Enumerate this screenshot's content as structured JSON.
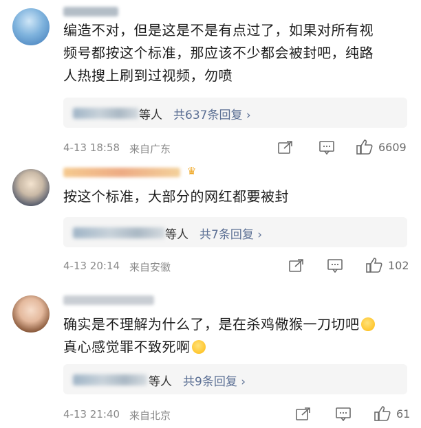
{
  "comments": [
    {
      "text_lines": [
        "编造不对，但是这是不是有点过了，如果对所有视",
        "频号都按这个标准，那应该不少都会被封吧，纯路",
        "人热搜上刷到过视频，勿喷"
      ],
      "replies_who": "等人",
      "replies_link": "共637条回复 ›",
      "time": "4-13 18:58",
      "location": "来自广东",
      "likes": "6609"
    },
    {
      "text_lines": [
        "按这个标准，大部分的网红都要被封"
      ],
      "replies_who": "等人",
      "replies_link": "共7条回复 ›",
      "time": "4-13 20:14",
      "location": "来自安徽",
      "likes": "102"
    },
    {
      "text_lines": [
        "确实是不理解为什么了，是在杀鸡儆猴一刀切吧",
        "真心感觉罪不致死啊"
      ],
      "replies_who": "等人",
      "replies_link": "共9条回复 ›",
      "time": "4-13 21:40",
      "location": "来自北京",
      "likes": "61"
    }
  ],
  "icons": {
    "share": "share-icon",
    "comment": "comment-icon",
    "like": "thumbs-up-icon"
  },
  "colors": {
    "link": "#5b6f94",
    "meta": "#8a8a8a",
    "reply_bg": "#f5f5f5"
  }
}
